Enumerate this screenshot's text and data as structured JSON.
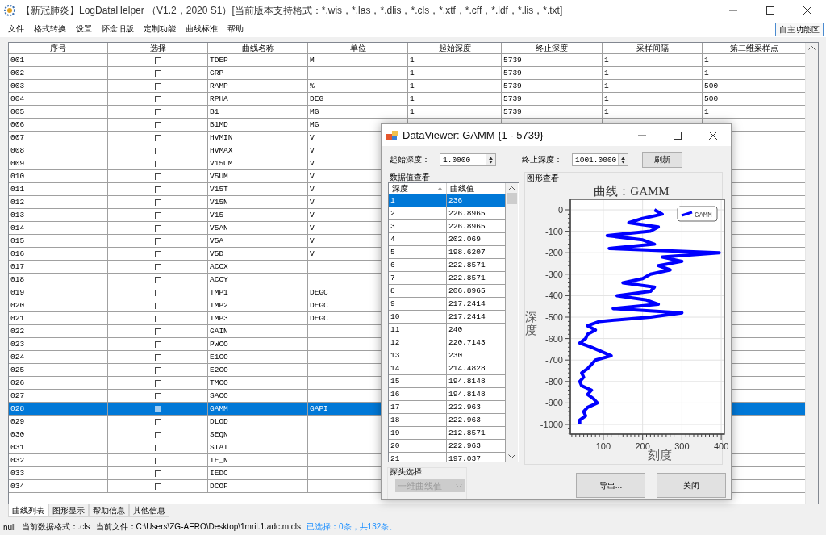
{
  "window": {
    "title": "【新冠肺炎】LogDataHelper （V1.2，2020 S1）[当前版本支持格式：*.wis，*.las，*.dlis，*.cls，*.xtf，*.cff，*.ldf，*.lis，*.txt]",
    "menu": [
      "文件",
      "格式转换",
      "设置",
      "怀念旧版",
      "定制功能",
      "曲线标准",
      "帮助"
    ],
    "side_button": "自主功能区"
  },
  "curve_table": {
    "columns": [
      "序号",
      "选择",
      "曲线名称",
      "单位",
      "起始深度",
      "终止深度",
      "采样间隔",
      "第二维采样点"
    ],
    "rows": [
      {
        "no": "001",
        "checked": false,
        "name": "TDEP",
        "unit": "M",
        "start": "1",
        "end": "5739",
        "step": "1",
        "dim2": "1",
        "selected": false
      },
      {
        "no": "002",
        "checked": false,
        "name": "GRP",
        "start": "1",
        "end": "5739",
        "step": "1",
        "dim2": "1",
        "selected": false
      },
      {
        "no": "003",
        "checked": false,
        "name": "RAMP",
        "unit": "%",
        "start": "1",
        "end": "5739",
        "step": "1",
        "dim2": "500",
        "selected": false
      },
      {
        "no": "004",
        "checked": false,
        "name": "RPHA",
        "unit": "DEG",
        "start": "1",
        "end": "5739",
        "step": "1",
        "dim2": "500",
        "selected": false
      },
      {
        "no": "005",
        "checked": false,
        "name": "B1",
        "unit": "MG",
        "start": "1",
        "end": "5739",
        "step": "1",
        "dim2": "1",
        "selected": false
      },
      {
        "no": "006",
        "checked": false,
        "name": "B1MD",
        "unit": "MG",
        "selected": false
      },
      {
        "no": "007",
        "checked": false,
        "name": "HVMIN",
        "unit": "V",
        "selected": false
      },
      {
        "no": "008",
        "checked": false,
        "name": "HVMAX",
        "unit": "V",
        "selected": false
      },
      {
        "no": "009",
        "checked": false,
        "name": "V15UM",
        "unit": "V",
        "selected": false
      },
      {
        "no": "010",
        "checked": false,
        "name": "V5UM",
        "unit": "V",
        "selected": false
      },
      {
        "no": "011",
        "checked": false,
        "name": "V15T",
        "unit": "V",
        "selected": false
      },
      {
        "no": "012",
        "checked": false,
        "name": "V15N",
        "unit": "V",
        "selected": false
      },
      {
        "no": "013",
        "checked": false,
        "name": "V15",
        "unit": "V",
        "selected": false
      },
      {
        "no": "014",
        "checked": false,
        "name": "V5AN",
        "unit": "V",
        "selected": false
      },
      {
        "no": "015",
        "checked": false,
        "name": "V5A",
        "unit": "V",
        "selected": false
      },
      {
        "no": "016",
        "checked": false,
        "name": "V5D",
        "unit": "V",
        "selected": false
      },
      {
        "no": "017",
        "checked": false,
        "name": "ACCX",
        "selected": false
      },
      {
        "no": "018",
        "checked": false,
        "name": "ACCY",
        "selected": false
      },
      {
        "no": "019",
        "checked": false,
        "name": "TMP1",
        "unit": "DEGC",
        "selected": false
      },
      {
        "no": "020",
        "checked": false,
        "name": "TMP2",
        "unit": "DEGC",
        "selected": false
      },
      {
        "no": "021",
        "checked": false,
        "name": "TMP3",
        "unit": "DEGC",
        "selected": false
      },
      {
        "no": "022",
        "checked": false,
        "name": "GAIN",
        "selected": false
      },
      {
        "no": "023",
        "checked": false,
        "name": "PWCO",
        "selected": false
      },
      {
        "no": "024",
        "checked": false,
        "name": "E1CO",
        "selected": false
      },
      {
        "no": "025",
        "checked": false,
        "name": "E2CO",
        "selected": false
      },
      {
        "no": "026",
        "checked": false,
        "name": "TMCO",
        "selected": false
      },
      {
        "no": "027",
        "checked": false,
        "name": "SACO",
        "selected": false
      },
      {
        "no": "028",
        "checked": false,
        "name": "GAMM",
        "unit": "GAPI",
        "selected": true
      },
      {
        "no": "029",
        "checked": false,
        "name": "DLOD",
        "selected": false
      },
      {
        "no": "030",
        "checked": false,
        "name": "SEQN",
        "selected": false
      },
      {
        "no": "031",
        "checked": false,
        "name": "STAT",
        "selected": false
      },
      {
        "no": "032",
        "checked": false,
        "name": "IE_N",
        "selected": false
      },
      {
        "no": "033",
        "checked": false,
        "name": "IEDC",
        "selected": false
      },
      {
        "no": "034",
        "checked": false,
        "name": "DCOF",
        "selected": false
      }
    ]
  },
  "bottom_tabs": [
    {
      "label": "曲线列表",
      "selected": true
    },
    {
      "label": "图形显示",
      "selected": false
    },
    {
      "label": "帮助信息",
      "selected": false
    },
    {
      "label": "其他信息",
      "selected": false
    }
  ],
  "status_bar": [
    {
      "text": "null",
      "highlight": false
    },
    {
      "text": "当前数据格式：.cls",
      "highlight": false
    },
    {
      "text": "当前文件：C:\\Users\\ZG-AERO\\Desktop\\1mril.1.adc.m.cls",
      "highlight": false
    },
    {
      "text": "已选择：0条，共132条。",
      "highlight": true
    }
  ],
  "data_viewer": {
    "title": "DataViewer: GAMM {1 - 5739}",
    "start_depth": {
      "label": "起始深度：",
      "value": "1.0000"
    },
    "end_depth": {
      "label": "终止深度：",
      "value": "1001.0000"
    },
    "refresh_button": "刷新",
    "values_group": "数据值查看",
    "values_table": {
      "columns": [
        "深度",
        "曲线值"
      ],
      "rows": [
        {
          "depth": "1",
          "value": "236",
          "selected": true
        },
        {
          "depth": "2",
          "value": "226.8965",
          "selected": false
        },
        {
          "depth": "3",
          "value": "226.8965",
          "selected": false
        },
        {
          "depth": "4",
          "value": "202.069",
          "selected": false
        },
        {
          "depth": "5",
          "value": "198.6207",
          "selected": false
        },
        {
          "depth": "6",
          "value": "222.8571",
          "selected": false
        },
        {
          "depth": "7",
          "value": "222.8571",
          "selected": false
        },
        {
          "depth": "8",
          "value": "206.8965",
          "selected": false
        },
        {
          "depth": "9",
          "value": "217.2414",
          "selected": false
        },
        {
          "depth": "10",
          "value": "217.2414",
          "selected": false
        },
        {
          "depth": "11",
          "value": "240",
          "selected": false
        },
        {
          "depth": "12",
          "value": "220.7143",
          "selected": false
        },
        {
          "depth": "13",
          "value": "230",
          "selected": false
        },
        {
          "depth": "14",
          "value": "214.4828",
          "selected": false
        },
        {
          "depth": "15",
          "value": "194.8148",
          "selected": false
        },
        {
          "depth": "16",
          "value": "194.8148",
          "selected": false
        },
        {
          "depth": "17",
          "value": "222.963",
          "selected": false
        },
        {
          "depth": "18",
          "value": "222.963",
          "selected": false
        },
        {
          "depth": "19",
          "value": "212.8571",
          "selected": false
        },
        {
          "depth": "20",
          "value": "222.963",
          "selected": false
        },
        {
          "depth": "21",
          "value": "197.037",
          "selected": false
        }
      ]
    },
    "chart_group": "图形查看",
    "chart_data": {
      "type": "line",
      "title": "曲线：GAMM",
      "xlabel": "刻度",
      "ylabel": "深度",
      "xlim": [
        16,
        408
      ],
      "ylim": [
        -1045,
        49
      ],
      "xticks": [
        100,
        200,
        300,
        400
      ],
      "grid": true,
      "yticks": [
        0,
        -100,
        -200,
        -300,
        -400,
        -500,
        -600,
        -700,
        -800,
        -900,
        -1000
      ],
      "x": [
        230,
        250,
        200,
        165,
        240,
        220,
        110,
        200,
        230,
        115,
        395,
        250,
        300,
        240,
        270,
        220,
        200,
        150,
        230,
        220,
        135,
        210,
        240,
        125,
        300,
        220,
        90,
        60,
        80,
        60,
        55,
        40,
        70,
        95,
        120,
        80,
        70,
        60,
        45,
        50,
        40,
        45,
        70,
        60,
        75,
        85,
        60,
        50,
        55,
        40,
        40
      ],
      "series": [
        {
          "name": "GAMM",
          "color": "#0000ff",
          "values": [
            0,
            -20,
            -40,
            -60,
            -80,
            -100,
            -120,
            -140,
            -160,
            -180,
            -200,
            -220,
            -240,
            -260,
            -280,
            -300,
            -320,
            -340,
            -360,
            -380,
            -400,
            -420,
            -440,
            -460,
            -480,
            -500,
            -520,
            -540,
            -560,
            -580,
            -600,
            -620,
            -640,
            -660,
            -680,
            -700,
            -720,
            -740,
            -760,
            -780,
            -800,
            -820,
            -840,
            -860,
            -880,
            -900,
            -920,
            -940,
            -960,
            -980,
            -1000
          ]
        }
      ]
    },
    "probe_group": "探头选择",
    "probe_select": {
      "value": "一维曲线值",
      "disabled": true
    },
    "buttons": [
      "导出...",
      "关闭"
    ]
  }
}
